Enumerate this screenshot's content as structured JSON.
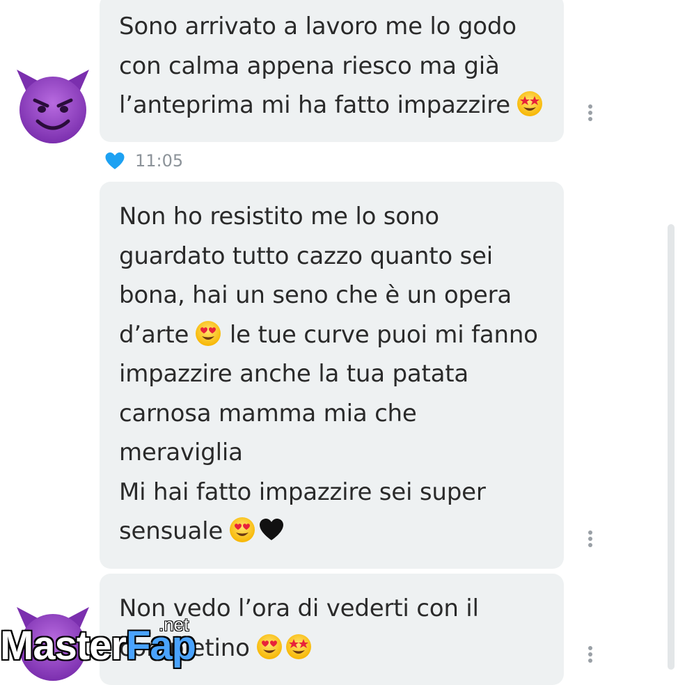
{
  "messages": [
    {
      "lines": [
        {
          "text": "Sono arrivato a lavoro me lo godo",
          "emoji": []
        },
        {
          "text": "con calma appena riesco ma già",
          "emoji": []
        },
        {
          "text": "l’anteprima mi ha fatto impazzire",
          "emoji": [
            "star-struck"
          ]
        }
      ],
      "read_time": "11:05"
    },
    {
      "lines": [
        {
          "text": "Non ho resistito me lo sono",
          "emoji": []
        },
        {
          "text": "guardato tutto cazzo quanto sei",
          "emoji": []
        },
        {
          "text": "bona, hai un seno che è un opera",
          "emoji": []
        },
        {
          "text": "d’arte",
          "emoji": [
            "heart-eyes"
          ],
          "after": "le tue curve puoi mi fanno"
        },
        {
          "text": "impazzire anche la tua patata",
          "emoji": []
        },
        {
          "text": "carnosa mamma mia che",
          "emoji": []
        },
        {
          "text": "meraviglia",
          "emoji": []
        },
        {
          "text": "Mi hai fatto impazzire sei super",
          "emoji": []
        },
        {
          "text": "sensuale",
          "emoji": [
            "heart-eyes",
            "black-heart"
          ]
        }
      ]
    },
    {
      "lines": [
        {
          "text": "Non vedo l’ora di vederti con il",
          "emoji": []
        },
        {
          "text": "completino",
          "emoji": [
            "heart-eyes",
            "star-struck"
          ]
        }
      ]
    }
  ],
  "avatar_icon": "smiling-devil-emoji",
  "liked_icon": "heart-icon",
  "liked_color": "#1da1f2",
  "bubble_color": "#eef1f2",
  "watermark": {
    "brand_a": "Master",
    "brand_b": "Fap",
    "suffix": ".net"
  }
}
